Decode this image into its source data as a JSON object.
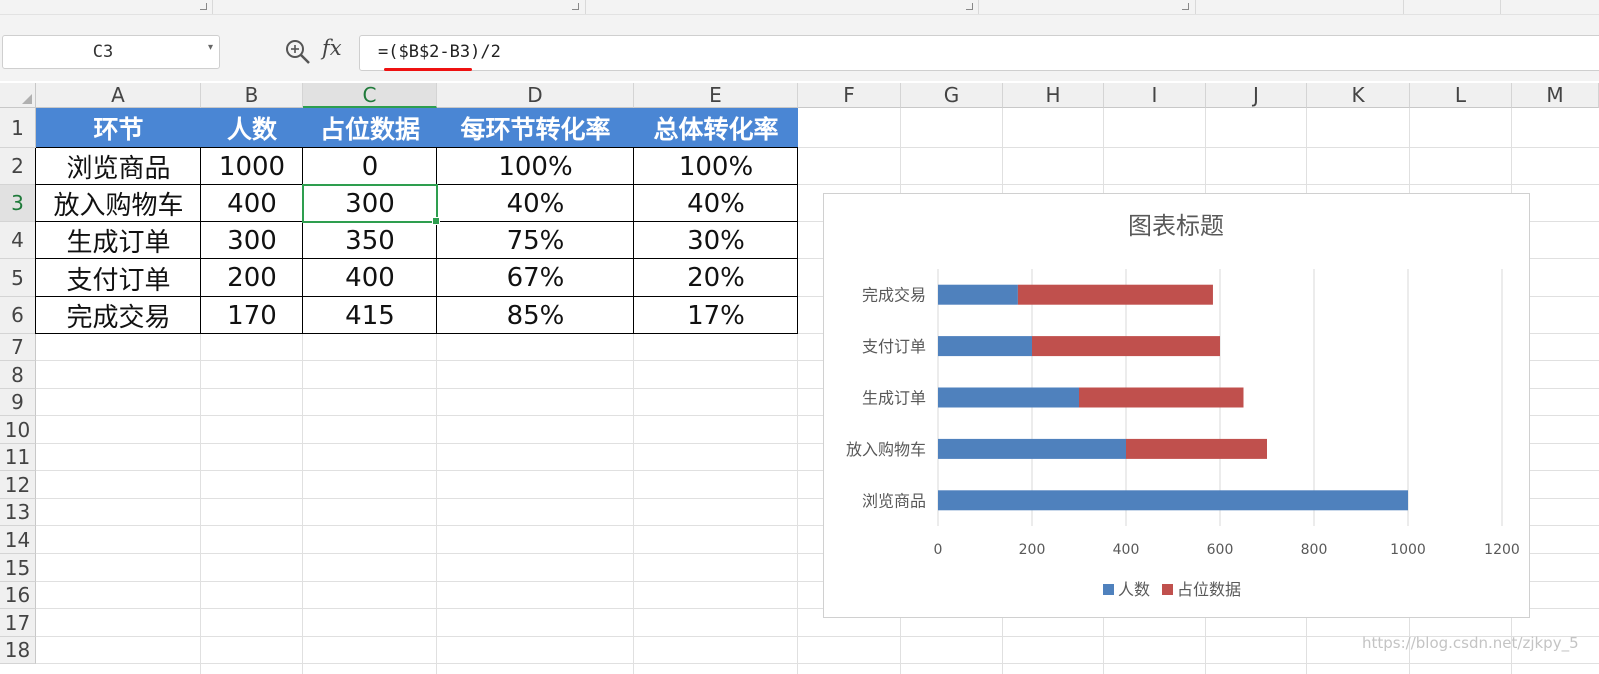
{
  "name_box": {
    "value": "C3"
  },
  "formula_bar": {
    "fx_label": "fx",
    "formula": "=($B$2-B3)/2"
  },
  "columns": [
    "A",
    "B",
    "C",
    "D",
    "E",
    "F",
    "G",
    "H",
    "I",
    "J",
    "K",
    "L",
    "M"
  ],
  "rows": [
    "1",
    "2",
    "3",
    "4",
    "5",
    "6",
    "7",
    "8",
    "9",
    "10",
    "11",
    "12",
    "13",
    "14",
    "15",
    "16",
    "17",
    "18"
  ],
  "selected_cell": {
    "column": "C",
    "row": "3"
  },
  "table": {
    "headers": [
      "环节",
      "人数",
      "占位数据",
      "每环节转化率",
      "总体转化率"
    ],
    "rows": [
      [
        "浏览商品",
        "1000",
        "0",
        "100%",
        "100%"
      ],
      [
        "放入购物车",
        "400",
        "300",
        "40%",
        "40%"
      ],
      [
        "生成订单",
        "300",
        "350",
        "75%",
        "30%"
      ],
      [
        "支付订单",
        "200",
        "400",
        "67%",
        "20%"
      ],
      [
        "完成交易",
        "170",
        "415",
        "85%",
        "17%"
      ]
    ]
  },
  "chart_data": {
    "type": "bar",
    "orientation": "horizontal",
    "stacked": true,
    "title": "图表标题",
    "categories": [
      "浏览商品",
      "放入购物车",
      "生成订单",
      "支付订单",
      "完成交易"
    ],
    "series": [
      {
        "name": "人数",
        "values": [
          1000,
          400,
          300,
          200,
          170
        ],
        "color": "#4f81bd"
      },
      {
        "name": "占位数据",
        "values": [
          0,
          300,
          350,
          400,
          415
        ],
        "color": "#c0504d"
      }
    ],
    "xlim": [
      0,
      1200
    ],
    "xticks": [
      "0",
      "200",
      "400",
      "600",
      "800",
      "1000",
      "1200"
    ],
    "grid": true,
    "legend": "bottom"
  },
  "watermark": "https://blog.csdn.net/zjkpy_5",
  "colors": {
    "header_fill": "#4a86d4",
    "selection": "#2e9e4f",
    "underline": "#e11111"
  }
}
